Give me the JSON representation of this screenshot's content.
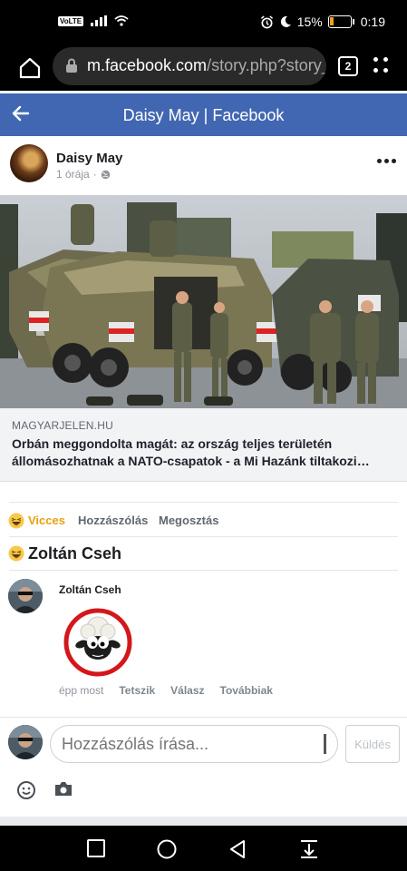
{
  "status_bar": {
    "network": "VoLTE",
    "battery_percent_text": "15%",
    "battery_level": 0.15,
    "time": "0:19"
  },
  "browser": {
    "url_host": "m.facebook.com",
    "url_path": "/story.php?story_f",
    "tab_count": "2"
  },
  "header": {
    "title": "Daisy May | Facebook"
  },
  "post": {
    "author": "Daisy May",
    "time": "1 órája",
    "link": {
      "domain": "MAGYARJELEN.HU",
      "headline": "Orbán meggondolta magát: az ország teljes területén állomásozhatnak a NATO-csapatok - a Mi Hazánk tiltakozi…"
    }
  },
  "actions": {
    "reaction": "Vicces",
    "comment": "Hozzászólás",
    "share": "Megosztás"
  },
  "reactors": {
    "name": "Zoltán Cseh"
  },
  "comment": {
    "author": "Zoltán Cseh",
    "time": "épp most",
    "like": "Tetszik",
    "reply": "Válasz",
    "more": "Továbbiak"
  },
  "composer": {
    "placeholder": "Hozzászólás írása...",
    "send_label": "Küldés"
  },
  "colors": {
    "facebook_blue": "#4267b2",
    "haha_yellow": "#f7c948"
  }
}
